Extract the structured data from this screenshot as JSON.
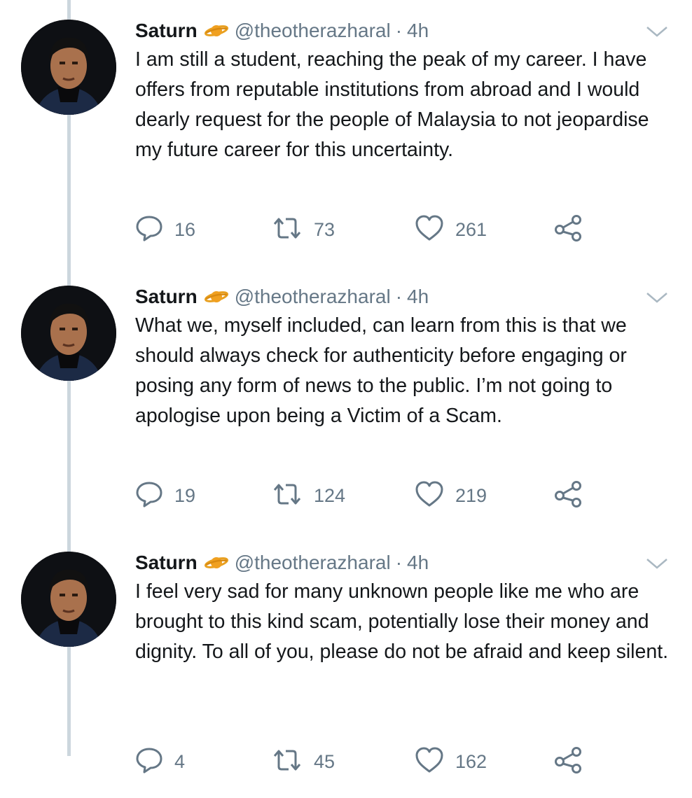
{
  "accent_color": "#657786",
  "badge_icon": "saturn-planet-emoji",
  "tweets": [
    {
      "name": "Saturn",
      "handle": "@theotherazharal",
      "separator": "·",
      "time": "4h",
      "text": "I am still a student, reaching the peak of my career. I have offers from reputable institutions from abroad and I would dearly request for the people of Malaysia to not jeopardise my future career for this uncertainty.",
      "replies": "16",
      "retweets": "73",
      "likes": "261"
    },
    {
      "name": "Saturn",
      "handle": "@theotherazharal",
      "separator": "·",
      "time": "4h",
      "text": "What we, myself included, can learn from this is that we should always check for authenticity before engaging or posing any form of news to the public. I’m not going to apologise upon being a Victim of a Scam.",
      "replies": "19",
      "retweets": "124",
      "likes": "219"
    },
    {
      "name": "Saturn",
      "handle": "@theotherazharal",
      "separator": "·",
      "time": "4h",
      "text": "I feel very sad for many unknown people like me who are brought to this kind scam, potentially lose their money and dignity. To all of you, please do not be afraid and keep silent.",
      "replies": "4",
      "retweets": "45",
      "likes": "162"
    }
  ]
}
